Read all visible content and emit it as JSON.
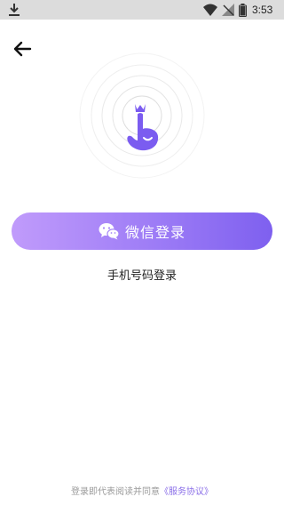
{
  "status_bar": {
    "time": "3:53",
    "icons": [
      "download-icon",
      "wifi-icon",
      "no-signal-icon",
      "battery-icon"
    ]
  },
  "header": {
    "back_icon": "arrow-left-icon"
  },
  "hero": {
    "icon": "finger-crown-logo-icon",
    "accent_color": "#7b5cf0"
  },
  "login": {
    "wechat_button_label": "微信登录",
    "wechat_icon": "wechat-icon",
    "gradient_colors": [
      "#c09bfb",
      "#7e60ef"
    ],
    "phone_login_label": "手机号码登录"
  },
  "footer": {
    "agreement_prefix": "登录即代表阅读并同意",
    "agreement_link": "《服务协议》"
  }
}
